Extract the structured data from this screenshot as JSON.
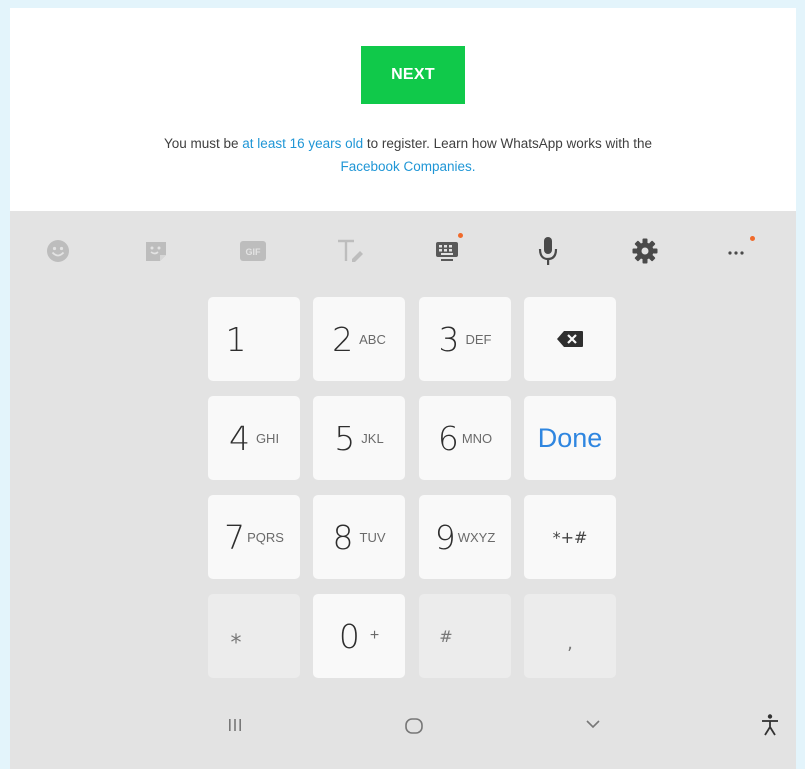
{
  "registration": {
    "next_label": "NEXT",
    "notice_prefix": "You must be ",
    "notice_age_link": "at least 16 years old",
    "notice_middle": " to register. Learn how WhatsApp works with the ",
    "notice_companies_link": "Facebook Companies."
  },
  "keyboard": {
    "toolbar": [
      "emoji-icon",
      "sticker-icon",
      "gif-icon",
      "handwriting-icon",
      "keyboard-layout-icon",
      "microphone-icon",
      "settings-gear-icon",
      "more-options-icon"
    ],
    "rows": [
      [
        {
          "num": "1",
          "letters": ""
        },
        {
          "num": "2",
          "letters": "ABC"
        },
        {
          "num": "3",
          "letters": "DEF"
        },
        {
          "action": "backspace"
        }
      ],
      [
        {
          "num": "4",
          "letters": "GHI"
        },
        {
          "num": "5",
          "letters": "JKL"
        },
        {
          "num": "6",
          "letters": "MNO"
        },
        {
          "action": "Done"
        }
      ],
      [
        {
          "num": "7",
          "letters": "PQRS"
        },
        {
          "num": "8",
          "letters": "TUV"
        },
        {
          "num": "9",
          "letters": "WXYZ"
        },
        {
          "action": "*+#"
        }
      ],
      [
        {
          "sym": "⁎"
        },
        {
          "num": "0",
          "letters": "+"
        },
        {
          "sym": "#"
        },
        {
          "sym": ","
        }
      ]
    ],
    "labels": {
      "k1": "1",
      "k2": "2",
      "k2l": "ABC",
      "k3": "3",
      "k3l": "DEF",
      "k4": "4",
      "k4l": "GHI",
      "k5": "5",
      "k5l": "JKL",
      "k6": "6",
      "k6l": "MNO",
      "k7": "7",
      "k7l": "PQRS",
      "k8": "8",
      "k8l": "TUV",
      "k9": "9",
      "k9l": "WXYZ",
      "k0": "0",
      "k0l": "+",
      "done": "Done",
      "symbols": "*+#",
      "asterisk": "⁎",
      "hash": "#",
      "comma": ","
    },
    "gif_label": "GIF"
  },
  "navigation": {
    "icons": [
      "recent-apps-icon",
      "home-icon",
      "hide-keyboard-icon",
      "accessibility-icon"
    ]
  },
  "colors": {
    "accent_green": "#10c94a",
    "link_blue": "#1f96d6",
    "done_blue": "#2f86e0",
    "notification_dot": "#f06a2b"
  }
}
